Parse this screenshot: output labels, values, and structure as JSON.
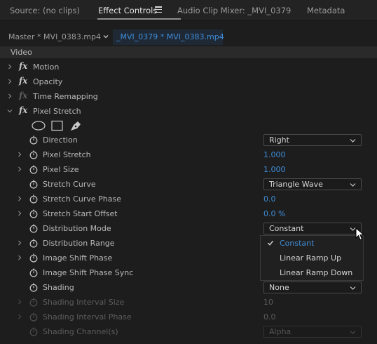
{
  "tabs": [
    {
      "label": "Source: (no clips)",
      "active": false
    },
    {
      "label": "Effect Controls",
      "active": true
    },
    {
      "label": "Audio Clip Mixer: _MVI_0379",
      "active": false
    },
    {
      "label": "Metadata",
      "active": false
    }
  ],
  "clip_bar": {
    "master_label": "Master * MVI_0383.mp4",
    "sequence_label": "_MVI_0379 * MVI_0383.mp4"
  },
  "section_header": "Video",
  "effects": {
    "motion": "Motion",
    "opacity": "Opacity",
    "time_remapping": "Time Remapping",
    "pixel_stretch": "Pixel Stretch"
  },
  "params": {
    "direction": {
      "label": "Direction",
      "value": "Right"
    },
    "pixel_stretch": {
      "label": "Pixel Stretch",
      "value": "1.000"
    },
    "pixel_size": {
      "label": "Pixel Size",
      "value": "1.000"
    },
    "stretch_curve": {
      "label": "Stretch Curve",
      "value": "Triangle Wave"
    },
    "stretch_curve_phase": {
      "label": "Stretch Curve Phase",
      "value": "0.0"
    },
    "stretch_start_offset": {
      "label": "Stretch Start Offset",
      "value": "0.0 %"
    },
    "distribution_mode": {
      "label": "Distribution Mode",
      "value": "Constant"
    },
    "distribution_range": {
      "label": "Distribution Range"
    },
    "image_shift_phase": {
      "label": "Image Shift Phase"
    },
    "image_shift_phase_sync": {
      "label": "Image Shift Phase Sync"
    },
    "shading": {
      "label": "Shading",
      "value": "None"
    },
    "shading_interval_size": {
      "label": "Shading Interval Size",
      "value": "10"
    },
    "shading_interval_phase": {
      "label": "Shading Interval Phase",
      "value": "0.0"
    },
    "shading_channels": {
      "label": "Shading Channel(s)",
      "value": "Alpha"
    }
  },
  "distribution_menu": {
    "options": [
      "Constant",
      "Linear Ramp Up",
      "Linear Ramp Down"
    ],
    "selected": "Constant"
  },
  "colors": {
    "accent_blue": "#3f8cd6",
    "panel_bg": "#1d1d1d"
  },
  "icons": [
    "hamburger-menu-icon",
    "chevron-down-icon",
    "disclosure-triangle-icon",
    "fx-icon",
    "stopwatch-icon",
    "ellipse-mask-icon",
    "rectangle-mask-icon",
    "pen-mask-icon",
    "checkmark-icon",
    "mouse-pointer-icon"
  ]
}
